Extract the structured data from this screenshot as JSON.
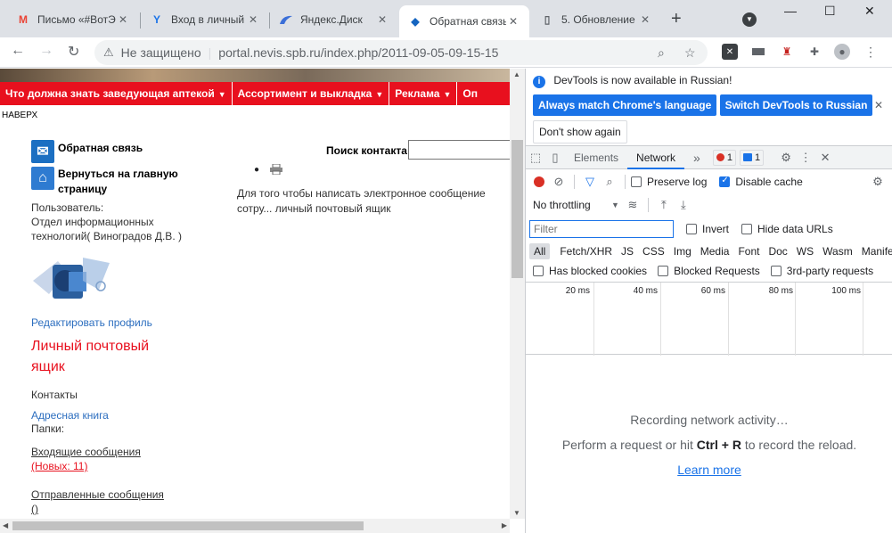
{
  "browser": {
    "tabs": [
      {
        "title": "Письмо «#ВотЭ",
        "favicon": "gmail-icon"
      },
      {
        "title": "Вход в личный",
        "favicon": "yandex-icon"
      },
      {
        "title": "Яндекс.Диск",
        "favicon": "yandex-disk-icon"
      },
      {
        "title": "Обратная связь",
        "favicon": "joomla-icon"
      },
      {
        "title": "5. Обновление",
        "favicon": "page-icon"
      }
    ],
    "address": {
      "security": "Не защищено",
      "url": "portal.nevis.spb.ru/index.php/2011-09-05-09-15-15"
    }
  },
  "page": {
    "menu": [
      "Что должна знать заведующая аптекой",
      "Ассортимент и выкладка",
      "Реклама",
      "Оп"
    ],
    "naverh": "НАВЕРХ",
    "feedback": "Обратная связь",
    "home": "Вернуться на главную страницу",
    "user_label": "Пользователь:",
    "user_name": "Отдел информационных технологий( Виноградов Д.В. )",
    "edit_profile": "Редактировать профиль",
    "mailbox_title": "Личный почтовый ящик",
    "contacts": "Контакты",
    "address_book": "Адресная книга",
    "folders": "Папки:",
    "inbox": "Входящие сообщения",
    "inbox_new": "(Новых: 11)",
    "sent": "Отправленные сообщения",
    "sent_count": "()",
    "search_label": "Поиск контакта:",
    "message_text": "Для того чтобы написать электронное сообщение сотру... личный почтовый ящик"
  },
  "devtools": {
    "info": "DevTools is now available in Russian!",
    "btn_match": "Always match Chrome's language",
    "btn_switch": "Switch DevTools to Russian",
    "btn_dont_show": "Don't show again",
    "tabs": [
      "Elements",
      "Network"
    ],
    "more": "»",
    "errors": "1",
    "messages": "1",
    "preserve_log": "Preserve log",
    "disable_cache": "Disable cache",
    "throttling": "No throttling",
    "filter_placeholder": "Filter",
    "invert": "Invert",
    "hide_data_urls": "Hide data URLs",
    "types": [
      "All",
      "Fetch/XHR",
      "JS",
      "CSS",
      "Img",
      "Media",
      "Font",
      "Doc",
      "WS",
      "Wasm",
      "Manifest"
    ],
    "blocked_cookies": "Has blocked cookies",
    "blocked_requests": "Blocked Requests",
    "third_party": "3rd-party requests",
    "timeline": [
      "20 ms",
      "40 ms",
      "60 ms",
      "80 ms",
      "100 ms"
    ],
    "recording": "Recording network activity…",
    "perform_pre": "Perform a request or hit ",
    "perform_keys": "Ctrl + R",
    "perform_post": " to record the reload.",
    "learn_more": "Learn more"
  }
}
